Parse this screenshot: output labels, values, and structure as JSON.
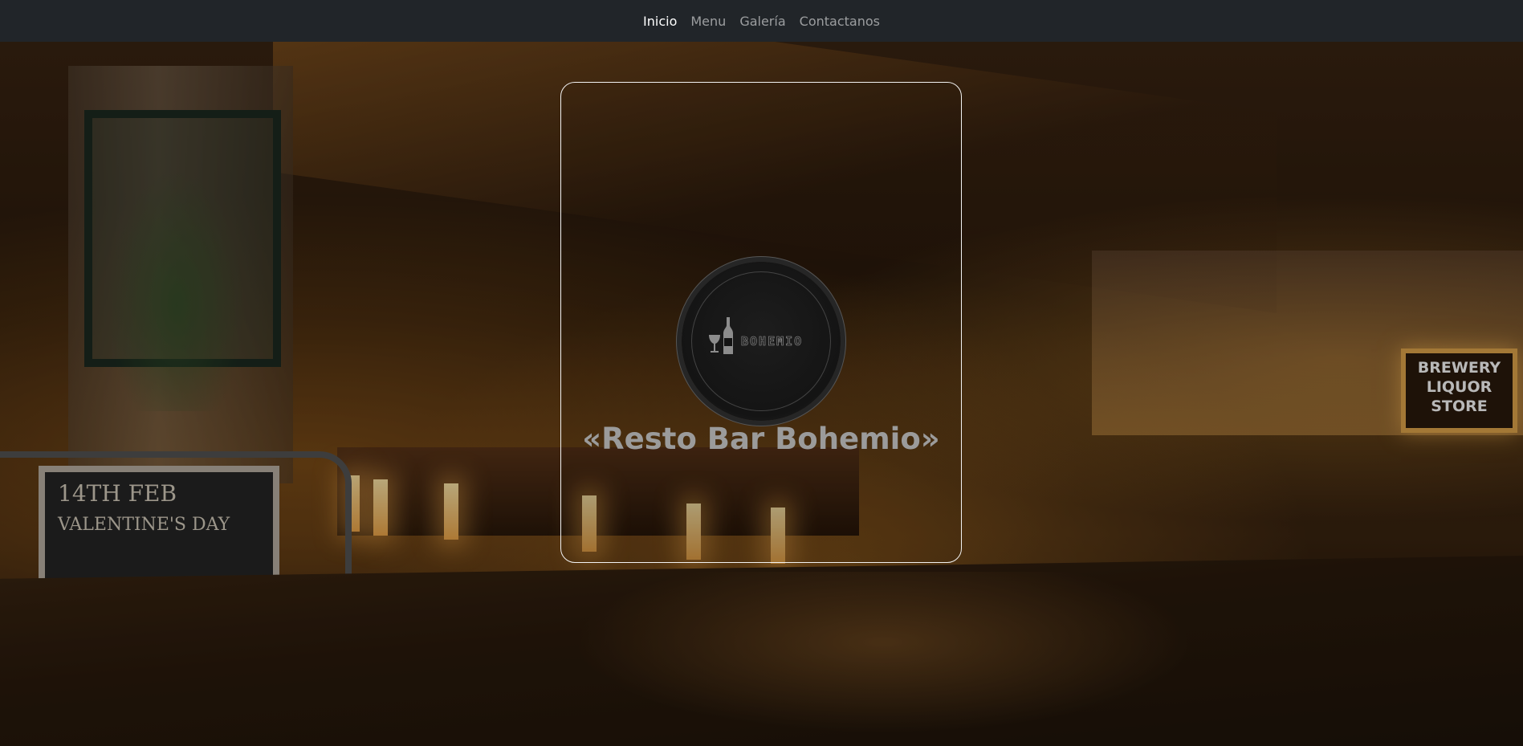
{
  "navbar": {
    "items": [
      {
        "label": "Inicio",
        "active": true
      },
      {
        "label": "Menu",
        "active": false
      },
      {
        "label": "Galería",
        "active": false
      },
      {
        "label": "Contactanos",
        "active": false
      }
    ],
    "background": "#212529"
  },
  "hero": {
    "logo_text": "BOHEMIO",
    "logo_icon": "wine-bottle-glass-icon",
    "title": "«Resto Bar Bohemio»",
    "background_scene": {
      "sign_lines": [
        "BREWERY",
        "LIQUOR",
        "STORE"
      ],
      "chalkboard_lines": [
        "14TH FEB",
        "VALENTINE'S DAY"
      ]
    }
  }
}
